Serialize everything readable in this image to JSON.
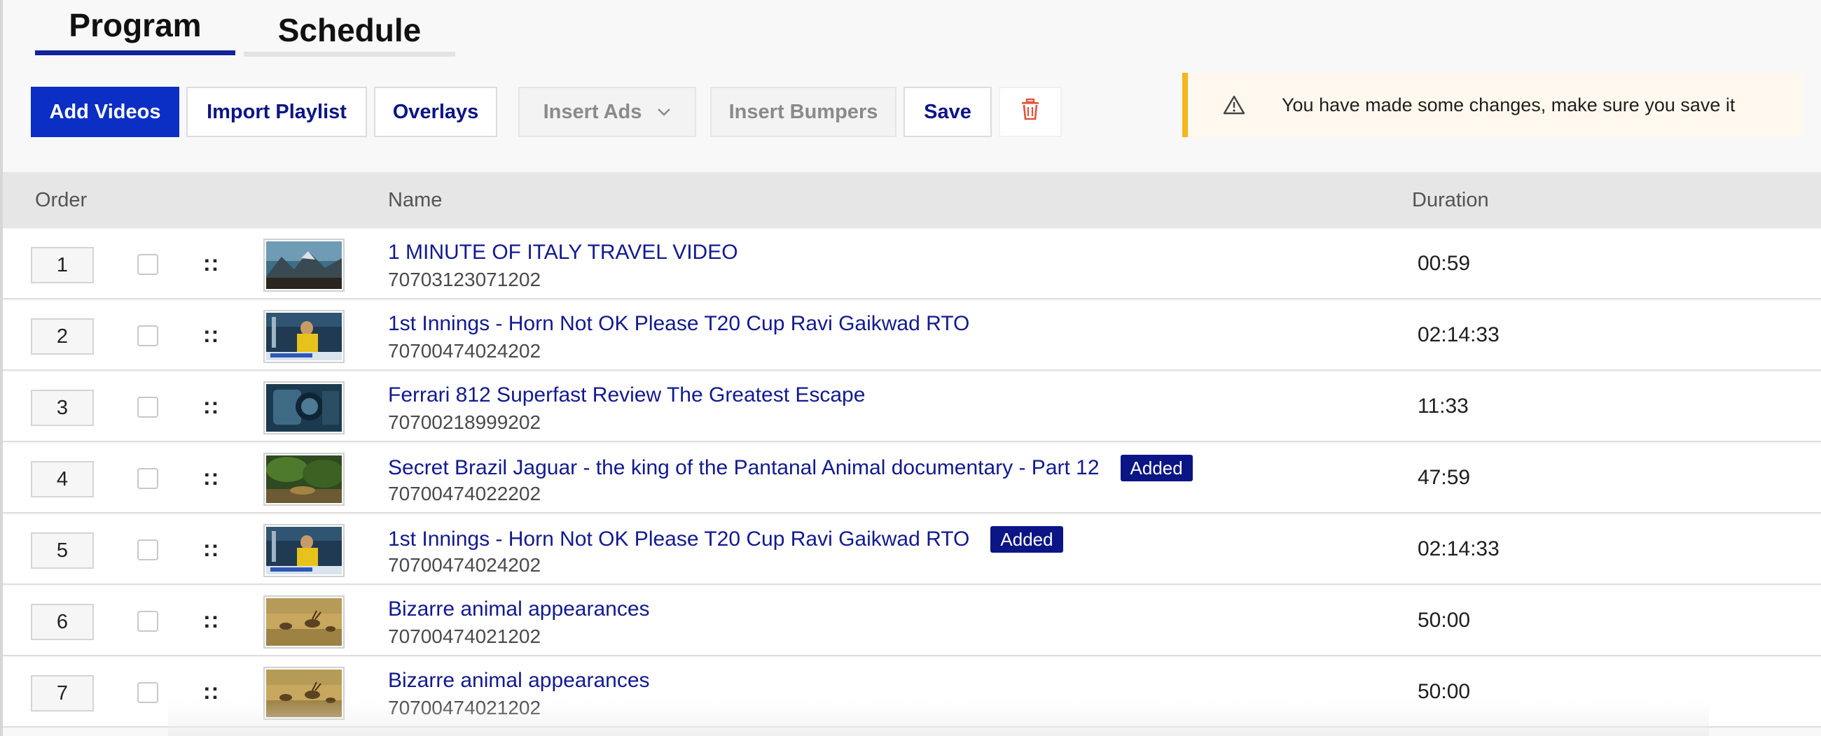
{
  "tabs": {
    "program": "Program",
    "schedule": "Schedule"
  },
  "toolbar": {
    "add_videos": "Add Videos",
    "import_playlist": "Import Playlist",
    "overlays": "Overlays",
    "insert_ads": "Insert Ads",
    "insert_bumpers": "Insert Bumpers",
    "save": "Save",
    "delete_icon": "trash-icon"
  },
  "notice": {
    "icon": "warning-triangle-icon",
    "text": "You have made some changes, make sure you save it"
  },
  "table": {
    "headers": {
      "order": "Order",
      "name": "Name",
      "duration": "Duration"
    },
    "rows": [
      {
        "order": "1",
        "title": "1 MINUTE OF ITALY TRAVEL VIDEO",
        "id": "70703123071202",
        "duration": "00:59",
        "badge": ""
      },
      {
        "order": "2",
        "title": "1st Innings - Horn Not OK Please T20 Cup Ravi Gaikwad RTO",
        "id": "70700474024202",
        "duration": "02:14:33",
        "badge": ""
      },
      {
        "order": "3",
        "title": "Ferrari 812 Superfast Review The Greatest Escape",
        "id": "70700218999202",
        "duration": "11:33",
        "badge": ""
      },
      {
        "order": "4",
        "title": "Secret Brazil Jaguar - the king of the Pantanal Animal documentary - Part 12",
        "id": "70700474022202",
        "duration": "47:59",
        "badge": "Added"
      },
      {
        "order": "5",
        "title": "1st Innings - Horn Not OK Please T20 Cup Ravi Gaikwad RTO",
        "id": "70700474024202",
        "duration": "02:14:33",
        "badge": "Added"
      },
      {
        "order": "6",
        "title": "Bizarre animal appearances",
        "id": "70700474021202",
        "duration": "50:00",
        "badge": ""
      },
      {
        "order": "7",
        "title": "Bizarre animal appearances",
        "id": "70700474021202",
        "duration": "50:00",
        "badge": ""
      }
    ]
  },
  "colors": {
    "accent": "#0b2ec4",
    "link": "#121a8f",
    "warning": "#f5b51c",
    "delete": "#e0533a"
  }
}
